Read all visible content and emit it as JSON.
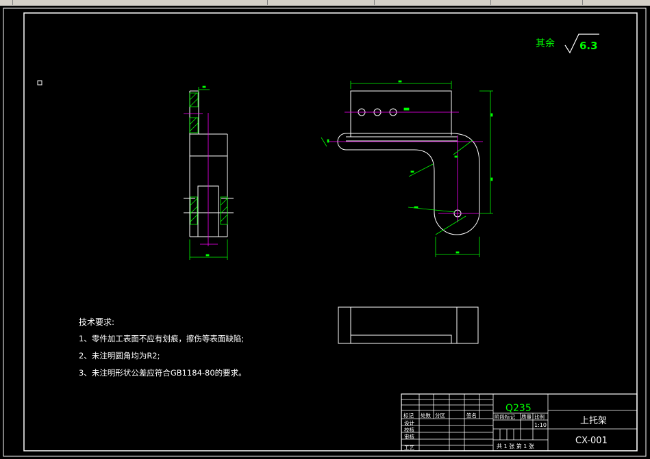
{
  "drawing": {
    "roughness_prefix": "其余",
    "roughness_value": "6.3",
    "tech_title": "技术要求:",
    "tech_reqs": [
      "1、零件加工表面不应有划痕，擦伤等表面缺陷;",
      "2、未注明圆角均为R2;",
      "3、未注明形状公差应符合GB1184-80的要求。"
    ]
  },
  "title_block": {
    "material": "Q235",
    "part_name": "上托架",
    "drawing_no": "CX-001",
    "scale": "1:10",
    "sheets": "共 1 张  第 1 张",
    "rev_headers": [
      "标记",
      "处数",
      "分区",
      "",
      "签名"
    ],
    "row_labels": [
      "设计",
      "校核",
      "审核",
      "工艺"
    ],
    "stage_headers": [
      "阶段标记",
      "质量",
      "比例"
    ]
  },
  "colors": {
    "background": "#000000",
    "outline": "#ffffff",
    "dimension": "#00ff00",
    "centerline": "#ff00ff",
    "hatch": "#00ff00",
    "text_green": "#00ff00",
    "text_white": "#ffffff"
  }
}
